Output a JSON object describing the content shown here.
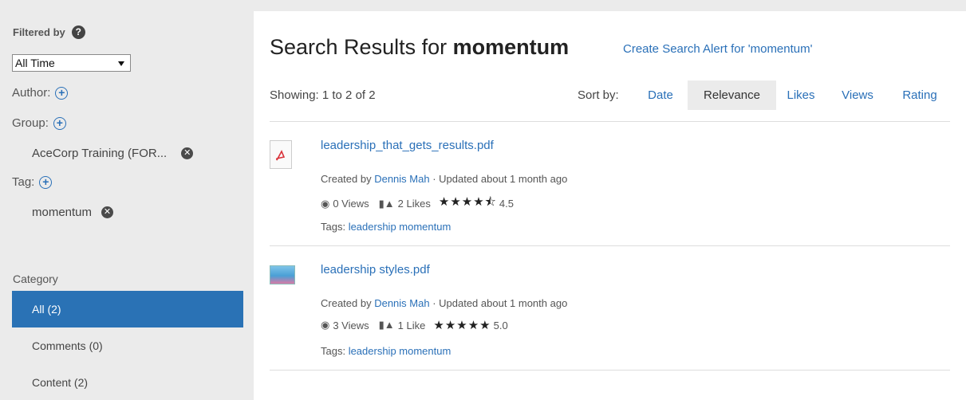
{
  "sidebar": {
    "filtered_by": "Filtered by",
    "time_filter": "All Time",
    "author_label": "Author:",
    "group_label": "Group:",
    "group_value": "AceCorp Training (FOR...",
    "tag_label": "Tag:",
    "tag_value": "momentum",
    "category_heading": "Category",
    "categories": [
      {
        "label": "All (2)",
        "active": true
      },
      {
        "label": "Comments (0)",
        "active": false
      },
      {
        "label": "Content (2)",
        "active": false
      }
    ]
  },
  "main": {
    "title_prefix": "Search Results for ",
    "query": "momentum",
    "alert_link": "Create Search Alert for 'momentum'",
    "showing": "Showing: 1 to 2 of 2",
    "sort_label": "Sort by:",
    "sort_options": [
      "Date",
      "Relevance",
      "Likes",
      "Views",
      "Rating"
    ],
    "sort_selected": "Relevance",
    "results": [
      {
        "title": "leadership_that_gets_results.pdf",
        "thumb_icon": "pdf-icon",
        "created_prefix": "Created by ",
        "author": "Dennis Mah",
        "updated": " · Updated about 1 month ago",
        "views": "0 Views",
        "likes": "2 Likes",
        "stars": "★★★★⯪",
        "rating": "4.5",
        "tags_label": "Tags: ",
        "tags": "leadership momentum"
      },
      {
        "title": "leadership styles.pdf",
        "thumb_icon": "image-thumbnail",
        "created_prefix": "Created by ",
        "author": "Dennis Mah",
        "updated": " · Updated about 1 month ago",
        "views": "3 Views",
        "likes": "1 Like",
        "stars": "★★★★★",
        "rating": "5.0",
        "tags_label": "Tags: ",
        "tags": "leadership momentum"
      }
    ]
  },
  "colors": {
    "accent": "#2a72b5",
    "link": "#2a70b8",
    "sidebar_bg": "#ebebeb"
  }
}
